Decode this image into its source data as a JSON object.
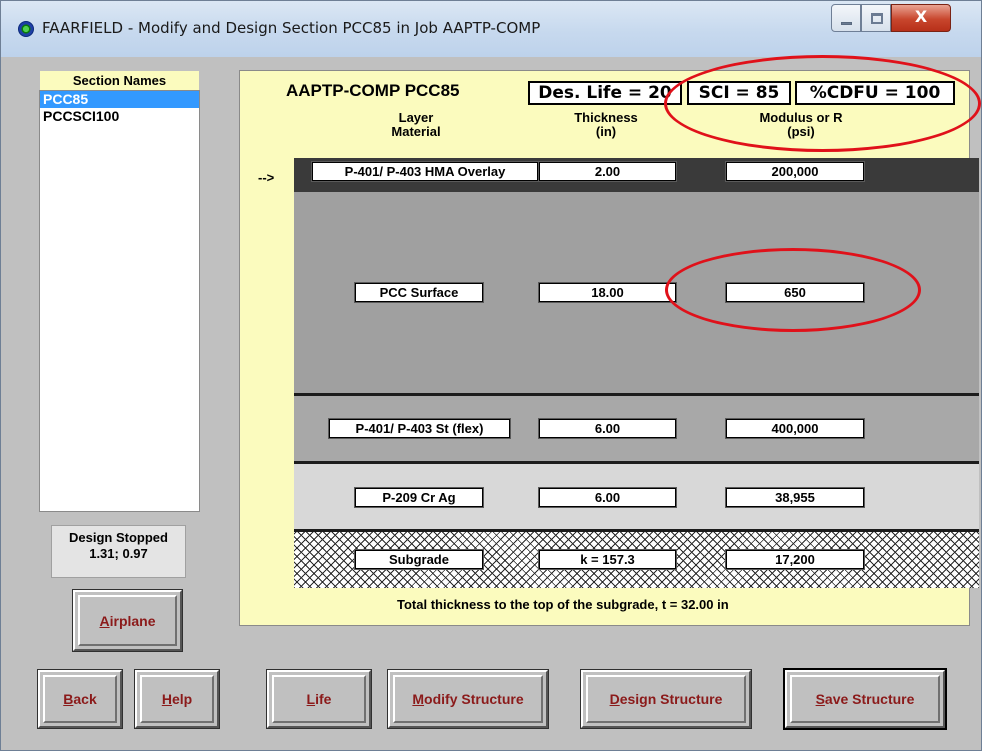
{
  "window": {
    "title": "FAARFIELD - Modify and Design Section PCC85 in Job AAPTP-COMP",
    "controls": {
      "minimize": "minimize-icon",
      "maximize": "maximize-icon",
      "close": "X"
    }
  },
  "sections": {
    "header": "Section Names",
    "items": [
      {
        "label": "PCC85",
        "selected": true
      },
      {
        "label": "PCCSCI100",
        "selected": false
      }
    ]
  },
  "status": {
    "line1": "Design Stopped",
    "line2": "1.31;  0.97"
  },
  "header": {
    "job_section": "AAPTP-COMP  PCC85",
    "des_life": "Des. Life = 20",
    "sci": "SCI = 85",
    "cdfu": "%CDFU = 100"
  },
  "columns": {
    "layer_line1": "Layer",
    "layer_line2": "Material",
    "thickness_line1": "Thickness",
    "thickness_line2": "(in)",
    "modulus_line1": "Modulus or R",
    "modulus_line2": "(psi)"
  },
  "current_marker": "-->",
  "layers": [
    {
      "material": "P-401/ P-403 HMA Overlay",
      "thickness": "2.00",
      "modulus": "200,000",
      "fill": "#3a3a3a"
    },
    {
      "material": "PCC Surface",
      "thickness": "18.00",
      "modulus": "650",
      "fill": "#a0a0a0"
    },
    {
      "material": "P-401/ P-403 St (flex)",
      "thickness": "6.00",
      "modulus": "400,000",
      "fill": "#a8a8a8"
    },
    {
      "material": "P-209 Cr Ag",
      "thickness": "6.00",
      "modulus": "38,955",
      "fill": "#d8d8d8"
    },
    {
      "material": "Subgrade",
      "thickness": "k = 157.3",
      "modulus": "17,200",
      "fill": "crosshatch"
    }
  ],
  "total_thickness": "Total thickness to the top of the subgrade, t = 32.00 in",
  "buttons": {
    "airplane": {
      "first": "A",
      "rest": "irplane"
    },
    "back": {
      "first": "B",
      "rest": "ack"
    },
    "help": {
      "first": "H",
      "rest": "elp"
    },
    "life": {
      "first": "L",
      "rest": "ife"
    },
    "modify": {
      "first": "M",
      "rest": "odify Structure"
    },
    "design": {
      "first": "D",
      "rest": "esign Structure"
    },
    "save": {
      "first": "S",
      "rest": "ave Structure"
    }
  },
  "annotations": {
    "color": "#e0111a"
  }
}
